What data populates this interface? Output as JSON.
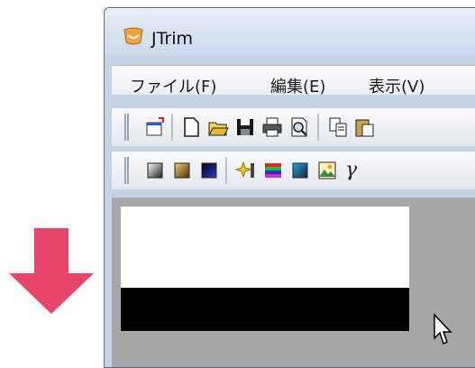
{
  "colors": {
    "arrow": "#e8456a",
    "canvas_bg": "#a7a7a7"
  },
  "window": {
    "title": "JTrim",
    "icon": "jtrim-smile-icon"
  },
  "menu": [
    {
      "label": "ファイル(F)"
    },
    {
      "label": "編集(E)"
    },
    {
      "label": "表示(V)"
    }
  ],
  "toolbar1": [
    "open-window-icon",
    "new-file-icon",
    "open-folder-icon",
    "save-icon",
    "print-icon",
    "print-preview-icon",
    "copy-icon",
    "paste-icon"
  ],
  "toolbar2": [
    "grayscale-gradient-icon",
    "sepia-icon",
    "blue-gradient-icon",
    "sparkle-effect-icon",
    "color-bars-icon",
    "color-balance-icon",
    "image-landscape-icon"
  ],
  "toolbar2_gamma": "γ"
}
